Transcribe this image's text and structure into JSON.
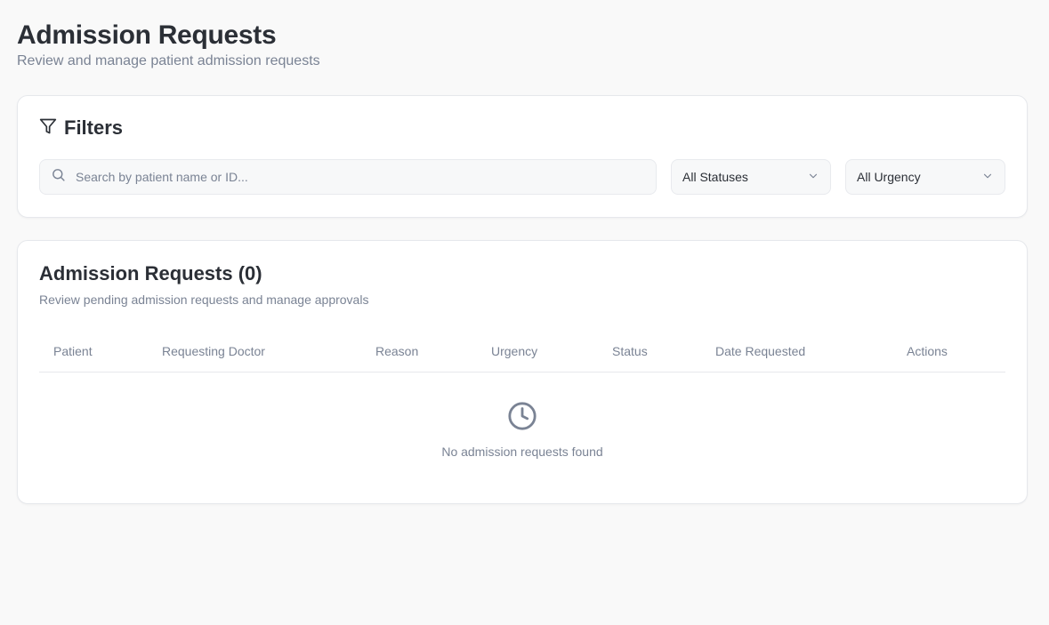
{
  "page": {
    "title": "Admission Requests",
    "subtitle": "Review and manage patient admission requests"
  },
  "filters": {
    "title": "Filters",
    "icon": "filter-icon",
    "search": {
      "placeholder": "Search by patient name or ID...",
      "value": "",
      "icon": "search-icon"
    },
    "status_select": {
      "selected": "All Statuses"
    },
    "urgency_select": {
      "selected": "All Urgency"
    }
  },
  "requests": {
    "title": "Admission Requests (0)",
    "subtitle": "Review pending admission requests and manage approvals",
    "columns": [
      "Patient",
      "Requesting Doctor",
      "Reason",
      "Urgency",
      "Status",
      "Date Requested",
      "Actions"
    ],
    "rows": [],
    "empty": {
      "icon": "clock-icon",
      "message": "No admission requests found"
    }
  },
  "colors": {
    "background": "#f9f9f9",
    "card": "#ffffff",
    "border": "#e6e8ec",
    "text_primary": "#2b2f36",
    "text_muted": "#7a8394"
  }
}
